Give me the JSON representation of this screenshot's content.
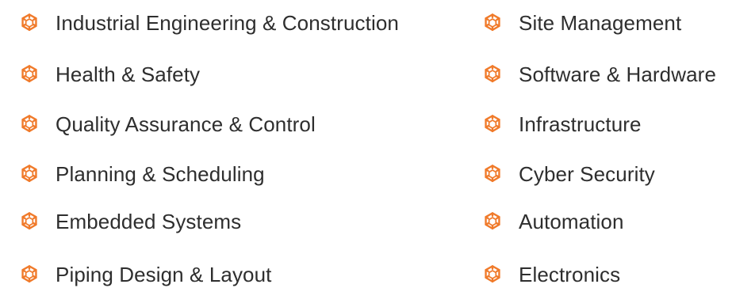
{
  "theme": {
    "accent": "#f07a2a",
    "text": "#2e2e2e",
    "background": "#ffffff"
  },
  "list": {
    "left": [
      {
        "label": "Industrial Engineering & Construction",
        "icon": "hexagon-swirl-icon"
      },
      {
        "label": "Health & Safety",
        "icon": "hexagon-swirl-icon"
      },
      {
        "label": "Quality Assurance & Control",
        "icon": "hexagon-swirl-icon"
      },
      {
        "label": "Planning & Scheduling",
        "icon": "hexagon-swirl-icon"
      },
      {
        "label": "Embedded Systems",
        "icon": "hexagon-swirl-icon"
      },
      {
        "label": "Piping Design & Layout",
        "icon": "hexagon-swirl-icon"
      }
    ],
    "right": [
      {
        "label": "Site Management",
        "icon": "hexagon-swirl-icon"
      },
      {
        "label": "Software & Hardware",
        "icon": "hexagon-swirl-icon"
      },
      {
        "label": "Infrastructure",
        "icon": "hexagon-swirl-icon"
      },
      {
        "label": "Cyber Security",
        "icon": "hexagon-swirl-icon"
      },
      {
        "label": "Automation",
        "icon": "hexagon-swirl-icon"
      },
      {
        "label": "Electronics",
        "icon": "hexagon-swirl-icon"
      }
    ]
  }
}
